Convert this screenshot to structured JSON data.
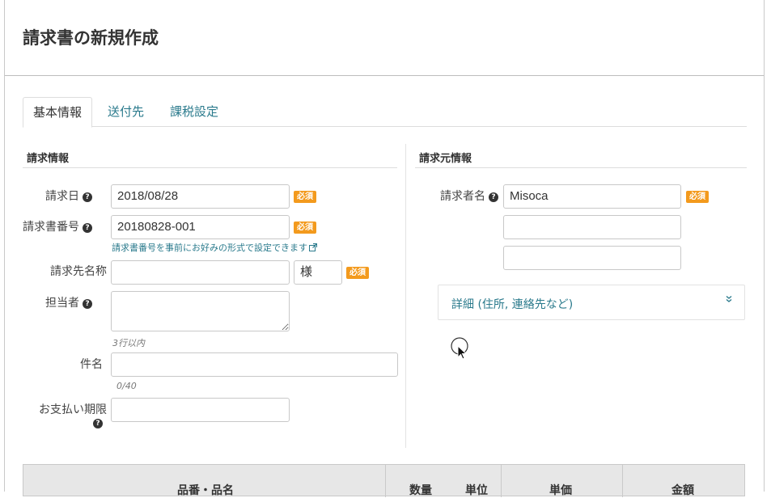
{
  "page": {
    "title": "請求書の新規作成"
  },
  "tabs": [
    {
      "label": "基本情報",
      "active": true
    },
    {
      "label": "送付先",
      "active": false
    },
    {
      "label": "課税設定",
      "active": false
    }
  ],
  "invoice_info": {
    "section_title": "請求情報",
    "required_badge": "必須",
    "date": {
      "label": "請求日",
      "value": "2018/08/28"
    },
    "number": {
      "label": "請求書番号",
      "value": "20180828-001",
      "hint_link": "請求書番号を事前にお好みの形式で設定できます"
    },
    "recipient": {
      "label": "請求先名称",
      "value": "",
      "honorific": "様"
    },
    "contact": {
      "label": "担当者",
      "value": "",
      "hint": "3行以内"
    },
    "subject": {
      "label": "件名",
      "value": "",
      "counter": "0/40"
    },
    "due": {
      "label": "お支払い期限",
      "value": ""
    }
  },
  "issuer_info": {
    "section_title": "請求元情報",
    "required_badge": "必須",
    "name": {
      "label": "請求者名",
      "value": "Misoca"
    },
    "extra1": "",
    "extra2": "",
    "details_label": "詳細 (住所, 連絡先など)"
  },
  "items_table": {
    "headers": [
      "品番・品名",
      "数量",
      "単位",
      "単価",
      "金額"
    ]
  },
  "colors": {
    "accent": "#2a7a8c",
    "badge": "#f39a1d"
  }
}
